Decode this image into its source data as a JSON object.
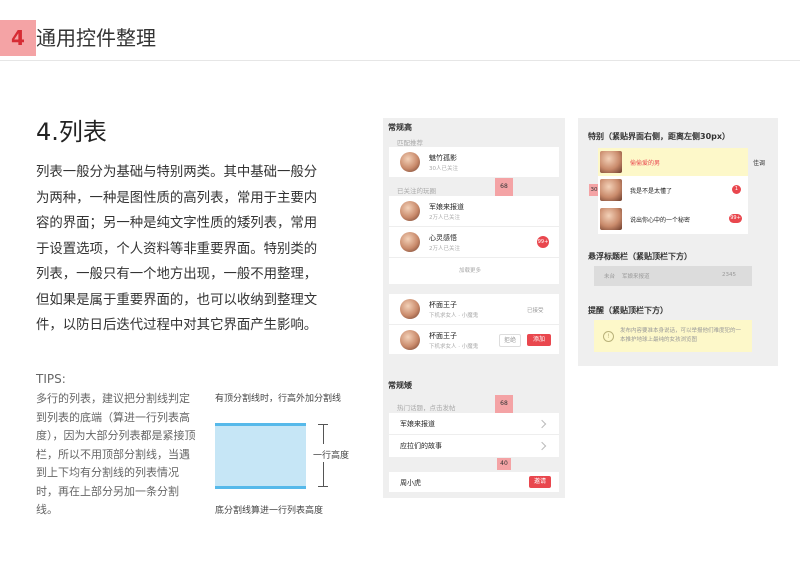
{
  "header": {
    "number": "4",
    "title": "通用控件整理"
  },
  "section": {
    "title": "4.列表"
  },
  "body": {
    "text": "列表一般分为基础与特别两类。其中基础一般分为两种，一种是图性质的高列表，常用于主要内容的界面；另一种是纯文字性质的矮列表，常用于设置选项，个人资料等非重要界面。特别类的列表，一般只有一个地方出现，一般不用整理，但如果是属于重要界面的，也可以收纳到整理文件，以防日后迭代过程中对其它界面产生影响。"
  },
  "tips": {
    "heading": "TIPS:",
    "text": "多行的列表，建议把分割线判定到列表的底端（算进一行列表高度），因为大部分列表都是紧接顶栏，所以不用顶部分割线，当遇到上下均有分割线的列表情况时，再在上部分另加一条分割线。"
  },
  "diagram": {
    "top_label": "有顶分割线时，行高外加分割线",
    "row_label": "一行高度",
    "bottom_label": "底分割线算进一行列表高度"
  },
  "panel_left": {
    "tall_title": "常规高",
    "group1_label": "匹配推荐",
    "item1_name": "魅竹孤影",
    "item1_sub": "30人已关注",
    "group2_label": "已关注的玩圈",
    "tag_68a": "68",
    "item2_name": "军娘来报道",
    "item2_sub": "2万人已关注",
    "item3_name": "心灵感悟",
    "item3_sub": "2万人已关注",
    "item3_badge": "99+",
    "more": "加载更多",
    "item4_name": "杯面王子",
    "item4_sub": "下机求女人 · 小魔鬼",
    "item4_status": "已接受",
    "item5_name": "杯面王子",
    "item5_sub": "下机求女人 · 小魔鬼",
    "item5_reject": "拒绝",
    "item5_add": "添加",
    "short_title": "常规矮",
    "group3_label": "热门话题，点击发帖",
    "tag_68b": "68",
    "s1": "军娘来报道",
    "s2": "应拉们的故事",
    "tag_40": "40",
    "s3": "周小虎",
    "s3_btn": "邀请"
  },
  "panel_right": {
    "title": "特别（紧贴界面右侧，距离左侧30px）",
    "r1": "偷偷爱的男",
    "r1_side": "佳调",
    "tag_30": "30",
    "r2": "我是不是太懂了",
    "r2_badge": "1",
    "r3": "说出你心中的一个秘密",
    "r3_badge": "99+",
    "sticky_title": "悬浮标题栏（紧贴顶栏下方）",
    "sticky_left": "未台",
    "sticky_mid": "军娘来报道",
    "sticky_count": "2345",
    "notice_title": "提醒（紧贴顶栏下方）",
    "notice_text": "发布内容要准本身说话，可以举报他们难度犯的一本推护地球上最纯的女孩浏览图"
  },
  "colors": {
    "accent": "#e9474e",
    "tag": "#f4a3a5",
    "divider": "#56b9ea",
    "highlight": "#fdf8c9"
  }
}
